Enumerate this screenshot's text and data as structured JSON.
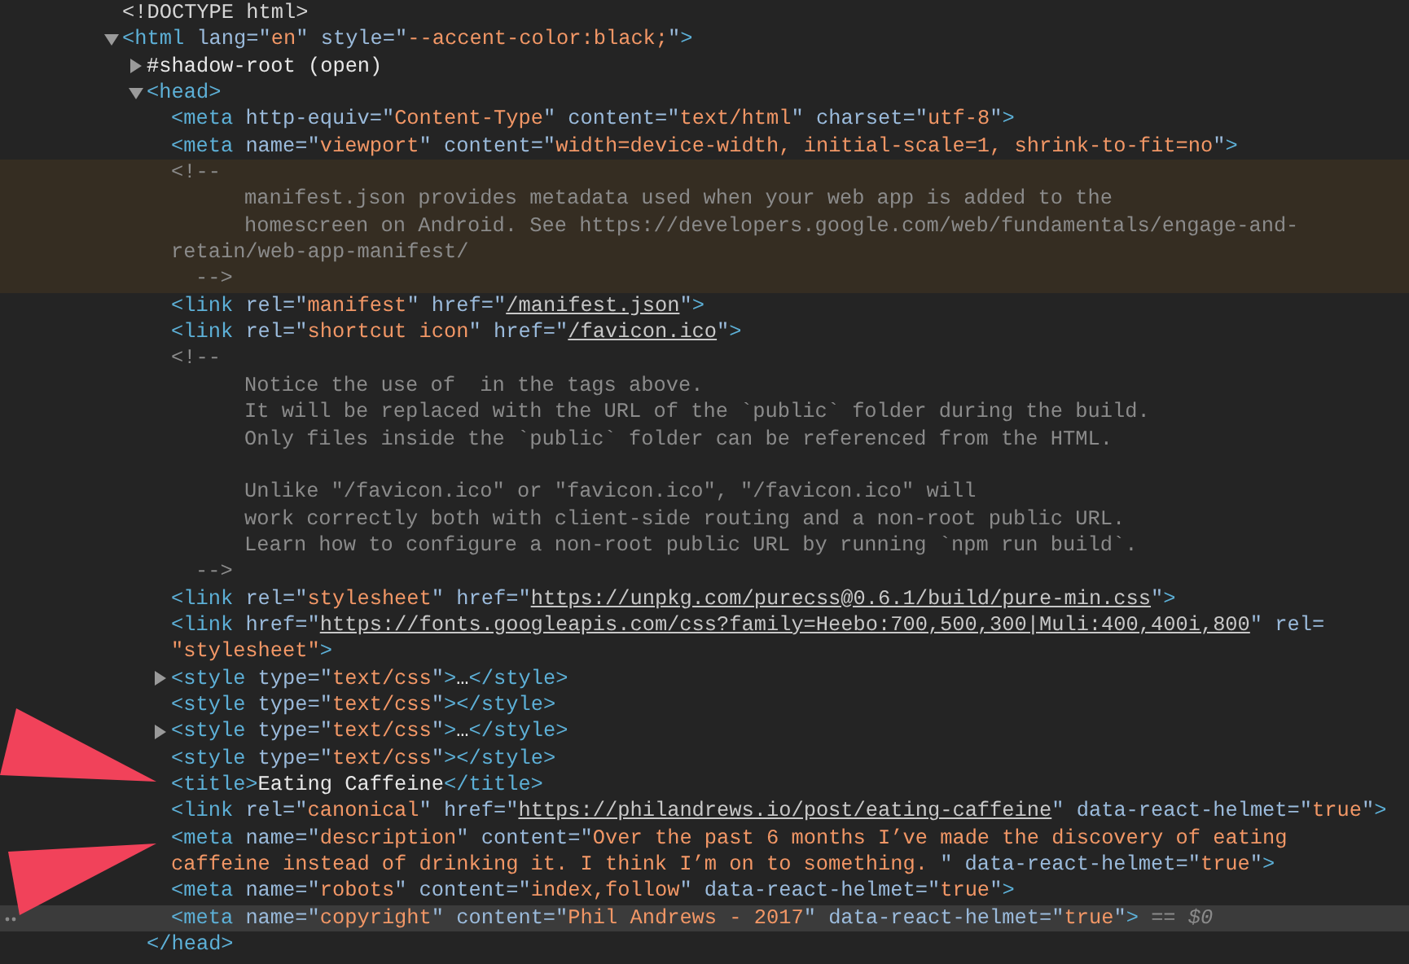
{
  "nodes": [
    {
      "selected": false,
      "hovered": false,
      "lines": [
        {
          "kind": "code",
          "tokens": [
            {
              "kind": "doctype",
              "text": "<!DOCTYPE html>"
            }
          ]
        }
      ]
    },
    {
      "selected": false,
      "hovered": false,
      "expanded": true,
      "lines": [
        {
          "kind": "code",
          "tokens": [
            {
              "kind": "tag",
              "text": "<html"
            },
            {
              "kind": "attr",
              "text": " lang=\""
            },
            {
              "kind": "value",
              "text": "en"
            },
            {
              "kind": "attr",
              "text": "\" style=\""
            },
            {
              "kind": "value",
              "text": "--accent-color:black;"
            },
            {
              "kind": "attr",
              "text": "\""
            },
            {
              "kind": "tag",
              "text": ">"
            }
          ]
        }
      ],
      "children": [
        {
          "selected": false,
          "hovered": false,
          "expanded": false,
          "lines": [
            {
              "kind": "code",
              "tokens": [
                {
                  "kind": "text",
                  "text": "#shadow-root (open)"
                }
              ]
            }
          ]
        },
        {
          "selected": false,
          "hovered": false,
          "expanded": true,
          "lines": [
            {
              "kind": "code",
              "tokens": [
                {
                  "kind": "tag",
                  "text": "<head>"
                }
              ]
            }
          ],
          "close": [
            {
              "kind": "tag",
              "text": "</head>"
            }
          ],
          "children": [
            {
              "selected": false,
              "hovered": false,
              "lines": [
                {
                  "kind": "code",
                  "tokens": [
                    {
                      "kind": "tag",
                      "text": "<meta"
                    },
                    {
                      "kind": "attr",
                      "text": " http-equiv=\""
                    },
                    {
                      "kind": "value",
                      "text": "Content-Type"
                    },
                    {
                      "kind": "attr",
                      "text": "\" content=\""
                    },
                    {
                      "kind": "value",
                      "text": "text/html"
                    },
                    {
                      "kind": "attr",
                      "text": "\" charset=\""
                    },
                    {
                      "kind": "value",
                      "text": "utf-8"
                    },
                    {
                      "kind": "attr",
                      "text": "\""
                    },
                    {
                      "kind": "tag",
                      "text": ">"
                    }
                  ]
                }
              ]
            },
            {
              "selected": false,
              "hovered": false,
              "lines": [
                {
                  "kind": "code",
                  "tokens": [
                    {
                      "kind": "tag",
                      "text": "<meta"
                    },
                    {
                      "kind": "attr",
                      "text": " name=\""
                    },
                    {
                      "kind": "value",
                      "text": "viewport"
                    },
                    {
                      "kind": "attr",
                      "text": "\" content=\""
                    },
                    {
                      "kind": "value",
                      "text": "width=device-width, initial-scale=1, shrink-to-fit=no"
                    },
                    {
                      "kind": "attr",
                      "text": "\""
                    },
                    {
                      "kind": "tag",
                      "text": ">"
                    }
                  ]
                }
              ]
            },
            {
              "selected": false,
              "hovered": true,
              "lines": [
                {
                  "kind": "code",
                  "tokens": [
                    {
                      "kind": "comment",
                      "text": "<!--"
                    }
                  ]
                },
                {
                  "kind": "body",
                  "tokens": [
                    {
                      "kind": "comment",
                      "text": "manifest.json provides metadata used when your web app is added to the"
                    }
                  ]
                },
                {
                  "kind": "body",
                  "tokens": [
                    {
                      "kind": "comment",
                      "text": "homescreen on Android. See https://developers.google.com/web/fundamentals/engage-and-"
                    }
                  ]
                },
                {
                  "kind": "code",
                  "tokens": [
                    {
                      "kind": "comment",
                      "text": "retain/web-app-manifest/"
                    }
                  ]
                },
                {
                  "kind": "end",
                  "tokens": [
                    {
                      "kind": "comment",
                      "text": "-->"
                    }
                  ]
                }
              ]
            },
            {
              "selected": false,
              "hovered": false,
              "lines": [
                {
                  "kind": "code",
                  "tokens": [
                    {
                      "kind": "tag",
                      "text": "<link"
                    },
                    {
                      "kind": "attr",
                      "text": " rel=\""
                    },
                    {
                      "kind": "value",
                      "text": "manifest"
                    },
                    {
                      "kind": "attr",
                      "text": "\" href=\""
                    },
                    {
                      "kind": "link",
                      "text": "/manifest.json"
                    },
                    {
                      "kind": "attr",
                      "text": "\""
                    },
                    {
                      "kind": "tag",
                      "text": ">"
                    }
                  ]
                }
              ]
            },
            {
              "selected": false,
              "hovered": false,
              "lines": [
                {
                  "kind": "code",
                  "tokens": [
                    {
                      "kind": "tag",
                      "text": "<link"
                    },
                    {
                      "kind": "attr",
                      "text": " rel=\""
                    },
                    {
                      "kind": "value",
                      "text": "shortcut icon"
                    },
                    {
                      "kind": "attr",
                      "text": "\" href=\""
                    },
                    {
                      "kind": "link",
                      "text": "/favicon.ico"
                    },
                    {
                      "kind": "attr",
                      "text": "\""
                    },
                    {
                      "kind": "tag",
                      "text": ">"
                    }
                  ]
                }
              ]
            },
            {
              "selected": false,
              "hovered": false,
              "lines": [
                {
                  "kind": "code",
                  "tokens": [
                    {
                      "kind": "comment",
                      "text": "<!--"
                    }
                  ]
                },
                {
                  "kind": "body",
                  "tokens": [
                    {
                      "kind": "comment",
                      "text": "Notice the use of  in the tags above."
                    }
                  ]
                },
                {
                  "kind": "body",
                  "tokens": [
                    {
                      "kind": "comment",
                      "text": "It will be replaced with the URL of the `public` folder during the build."
                    }
                  ]
                },
                {
                  "kind": "body",
                  "tokens": [
                    {
                      "kind": "comment",
                      "text": "Only files inside the `public` folder can be referenced from the HTML."
                    }
                  ]
                },
                {
                  "kind": "blank"
                },
                {
                  "kind": "body",
                  "tokens": [
                    {
                      "kind": "comment",
                      "text": "Unlike \"/favicon.ico\" or \"favicon.ico\", \"/favicon.ico\" will"
                    }
                  ]
                },
                {
                  "kind": "body",
                  "tokens": [
                    {
                      "kind": "comment",
                      "text": "work correctly both with client-side routing and a non-root public URL."
                    }
                  ]
                },
                {
                  "kind": "body",
                  "tokens": [
                    {
                      "kind": "comment",
                      "text": "Learn how to configure a non-root public URL by running `npm run build`."
                    }
                  ]
                },
                {
                  "kind": "end",
                  "tokens": [
                    {
                      "kind": "comment",
                      "text": "-->"
                    }
                  ]
                }
              ]
            },
            {
              "selected": false,
              "hovered": false,
              "lines": [
                {
                  "kind": "code",
                  "tokens": [
                    {
                      "kind": "tag",
                      "text": "<link"
                    },
                    {
                      "kind": "attr",
                      "text": " rel=\""
                    },
                    {
                      "kind": "value",
                      "text": "stylesheet"
                    },
                    {
                      "kind": "attr",
                      "text": "\" href=\""
                    },
                    {
                      "kind": "link",
                      "text": "https://unpkg.com/purecss@0.6.1/build/pure-min.css"
                    },
                    {
                      "kind": "attr",
                      "text": "\""
                    },
                    {
                      "kind": "tag",
                      "text": ">"
                    }
                  ]
                }
              ]
            },
            {
              "selected": false,
              "hovered": false,
              "lines": [
                {
                  "kind": "code",
                  "tokens": [
                    {
                      "kind": "tag",
                      "text": "<link"
                    },
                    {
                      "kind": "attr",
                      "text": " href=\""
                    },
                    {
                      "kind": "link",
                      "text": "https://fonts.googleapis.com/css?family=Heebo:700,500,300|Muli:400,400i,800"
                    },
                    {
                      "kind": "attr",
                      "text": "\" rel="
                    }
                  ]
                },
                {
                  "kind": "code",
                  "tokens": [
                    {
                      "kind": "value",
                      "text": "\"stylesheet\""
                    },
                    {
                      "kind": "tag",
                      "text": ">"
                    }
                  ]
                }
              ]
            },
            {
              "selected": false,
              "hovered": false,
              "expanded": false,
              "lines": [
                {
                  "kind": "code",
                  "tokens": [
                    {
                      "kind": "tag",
                      "text": "<style"
                    },
                    {
                      "kind": "attr",
                      "text": " type=\""
                    },
                    {
                      "kind": "value",
                      "text": "text/css"
                    },
                    {
                      "kind": "attr",
                      "text": "\""
                    },
                    {
                      "kind": "tag",
                      "text": ">"
                    },
                    {
                      "kind": "text",
                      "text": "…"
                    },
                    {
                      "kind": "tag",
                      "text": "</style>"
                    }
                  ]
                }
              ]
            },
            {
              "selected": false,
              "hovered": false,
              "lines": [
                {
                  "kind": "code",
                  "tokens": [
                    {
                      "kind": "tag",
                      "text": "<style"
                    },
                    {
                      "kind": "attr",
                      "text": " type=\""
                    },
                    {
                      "kind": "value",
                      "text": "text/css"
                    },
                    {
                      "kind": "attr",
                      "text": "\""
                    },
                    {
                      "kind": "tag",
                      "text": "></style>"
                    }
                  ]
                }
              ]
            },
            {
              "selected": false,
              "hovered": false,
              "expanded": false,
              "lines": [
                {
                  "kind": "code",
                  "tokens": [
                    {
                      "kind": "tag",
                      "text": "<style"
                    },
                    {
                      "kind": "attr",
                      "text": " type=\""
                    },
                    {
                      "kind": "value",
                      "text": "text/css"
                    },
                    {
                      "kind": "attr",
                      "text": "\""
                    },
                    {
                      "kind": "tag",
                      "text": ">"
                    },
                    {
                      "kind": "text",
                      "text": "…"
                    },
                    {
                      "kind": "tag",
                      "text": "</style>"
                    }
                  ]
                }
              ]
            },
            {
              "selected": false,
              "hovered": false,
              "lines": [
                {
                  "kind": "code",
                  "tokens": [
                    {
                      "kind": "tag",
                      "text": "<style"
                    },
                    {
                      "kind": "attr",
                      "text": " type=\""
                    },
                    {
                      "kind": "value",
                      "text": "text/css"
                    },
                    {
                      "kind": "attr",
                      "text": "\""
                    },
                    {
                      "kind": "tag",
                      "text": "></style>"
                    }
                  ]
                }
              ]
            },
            {
              "selected": false,
              "hovered": false,
              "lines": [
                {
                  "kind": "code",
                  "tokens": [
                    {
                      "kind": "tag",
                      "text": "<title>"
                    },
                    {
                      "kind": "text",
                      "text": "Eating Caffeine"
                    },
                    {
                      "kind": "tag",
                      "text": "</title>"
                    }
                  ]
                }
              ]
            },
            {
              "selected": false,
              "hovered": false,
              "lines": [
                {
                  "kind": "code",
                  "tokens": [
                    {
                      "kind": "tag",
                      "text": "<link"
                    },
                    {
                      "kind": "attr",
                      "text": " rel=\""
                    },
                    {
                      "kind": "value",
                      "text": "canonical"
                    },
                    {
                      "kind": "attr",
                      "text": "\" href=\""
                    },
                    {
                      "kind": "link",
                      "text": "https://philandrews.io/post/eating-caffeine"
                    },
                    {
                      "kind": "attr",
                      "text": "\" data-react-helmet=\""
                    },
                    {
                      "kind": "value",
                      "text": "true"
                    },
                    {
                      "kind": "attr",
                      "text": "\""
                    },
                    {
                      "kind": "tag",
                      "text": ">"
                    }
                  ]
                }
              ]
            },
            {
              "selected": false,
              "hovered": false,
              "lines": [
                {
                  "kind": "code",
                  "tokens": [
                    {
                      "kind": "tag",
                      "text": "<meta"
                    },
                    {
                      "kind": "attr",
                      "text": " name=\""
                    },
                    {
                      "kind": "value",
                      "text": "description"
                    },
                    {
                      "kind": "attr",
                      "text": "\" content=\""
                    },
                    {
                      "kind": "value",
                      "text": "Over the past 6 months I’ve made the discovery of eating"
                    }
                  ]
                },
                {
                  "kind": "code",
                  "tokens": [
                    {
                      "kind": "value",
                      "text": "caffeine instead of drinking it. I think I’m on to something. "
                    },
                    {
                      "kind": "attr",
                      "text": "\" data-react-helmet=\""
                    },
                    {
                      "kind": "value",
                      "text": "true"
                    },
                    {
                      "kind": "attr",
                      "text": "\""
                    },
                    {
                      "kind": "tag",
                      "text": ">"
                    }
                  ]
                }
              ]
            },
            {
              "selected": false,
              "hovered": false,
              "lines": [
                {
                  "kind": "code",
                  "tokens": [
                    {
                      "kind": "tag",
                      "text": "<meta"
                    },
                    {
                      "kind": "attr",
                      "text": " name=\""
                    },
                    {
                      "kind": "value",
                      "text": "robots"
                    },
                    {
                      "kind": "attr",
                      "text": "\" content=\""
                    },
                    {
                      "kind": "value",
                      "text": "index,follow"
                    },
                    {
                      "kind": "attr",
                      "text": "\" data-react-helmet=\""
                    },
                    {
                      "kind": "value",
                      "text": "true"
                    },
                    {
                      "kind": "attr",
                      "text": "\""
                    },
                    {
                      "kind": "tag",
                      "text": ">"
                    }
                  ]
                }
              ]
            },
            {
              "selected": true,
              "hovered": false,
              "lines": [
                {
                  "kind": "code",
                  "tokens": [
                    {
                      "kind": "tag",
                      "text": "<meta"
                    },
                    {
                      "kind": "attr",
                      "text": " name=\""
                    },
                    {
                      "kind": "value",
                      "text": "copyright"
                    },
                    {
                      "kind": "attr",
                      "text": "\" content=\""
                    },
                    {
                      "kind": "value",
                      "text": "Phil Andrews - 2017"
                    },
                    {
                      "kind": "attr",
                      "text": "\" data-react-helmet=\""
                    },
                    {
                      "kind": "value",
                      "text": "true"
                    },
                    {
                      "kind": "attr",
                      "text": "\""
                    },
                    {
                      "kind": "tag",
                      "text": ">"
                    },
                    {
                      "kind": "hint",
                      "text": " == $0"
                    }
                  ]
                }
              ]
            }
          ]
        }
      ]
    }
  ]
}
